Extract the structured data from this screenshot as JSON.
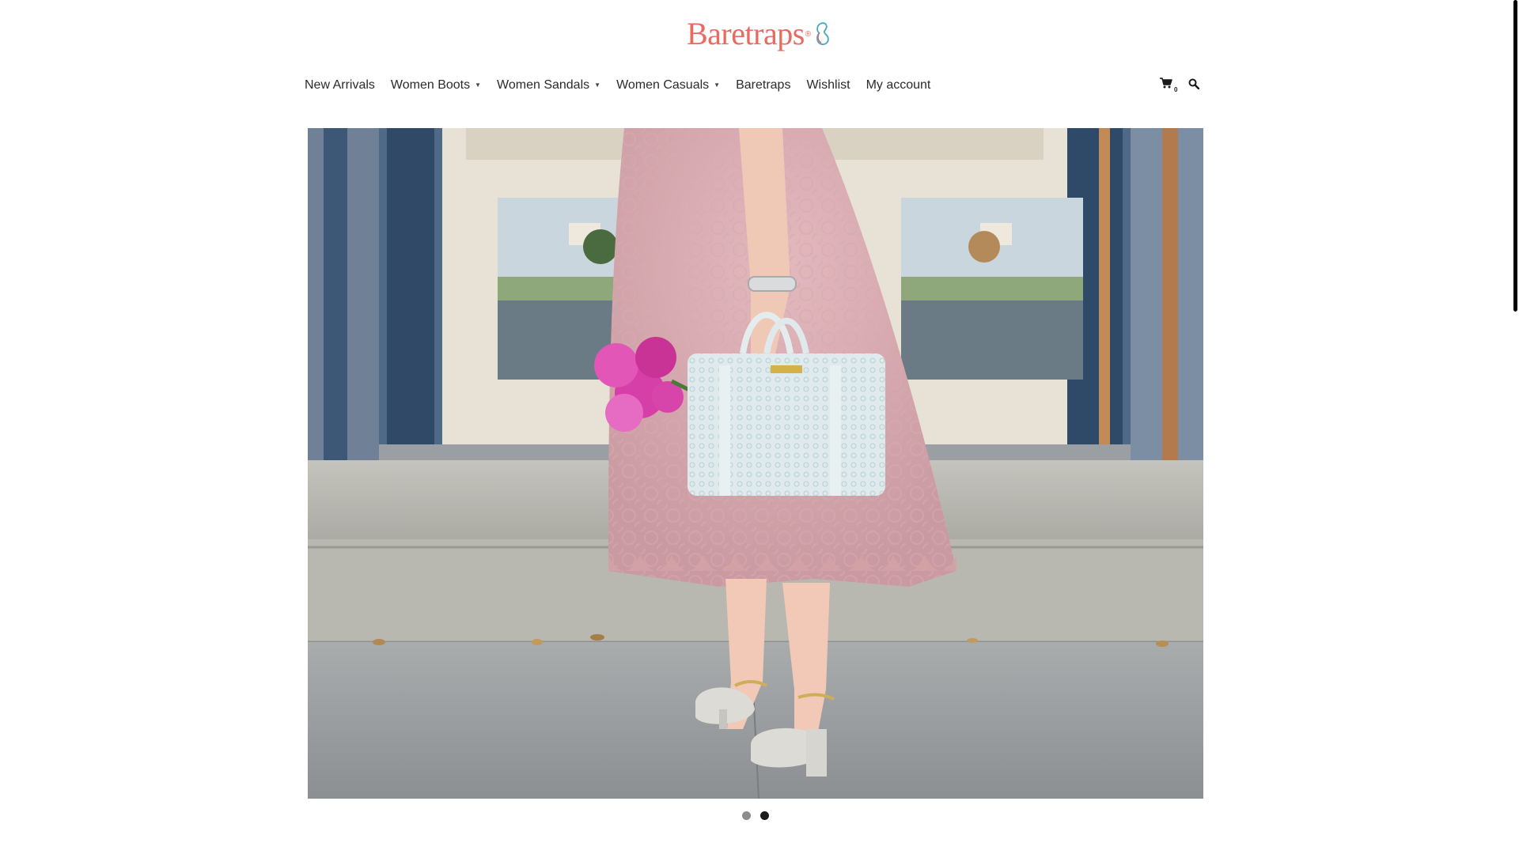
{
  "brand": {
    "logo_text": "Baretraps",
    "logo_reg": "®",
    "logo_color": "#e86a60",
    "logo_mark_color": "#4aa8c7"
  },
  "nav": {
    "items": [
      {
        "label": "New Arrivals",
        "has_dropdown": false
      },
      {
        "label": "Women Boots",
        "has_dropdown": true
      },
      {
        "label": "Women Sandals",
        "has_dropdown": true
      },
      {
        "label": "Women Casuals",
        "has_dropdown": true
      },
      {
        "label": "Baretraps",
        "has_dropdown": false
      },
      {
        "label": "Wishlist",
        "has_dropdown": false
      },
      {
        "label": "My account",
        "has_dropdown": false
      }
    ],
    "dropdown_icon": "chevron-down-icon"
  },
  "header_icons": {
    "cart_icon": "shopping-cart-icon",
    "cart_count": "0",
    "search_icon": "search-icon"
  },
  "hero": {
    "image_description_icon": "hero-photo",
    "slides_total": 2,
    "active_slide": 2
  }
}
